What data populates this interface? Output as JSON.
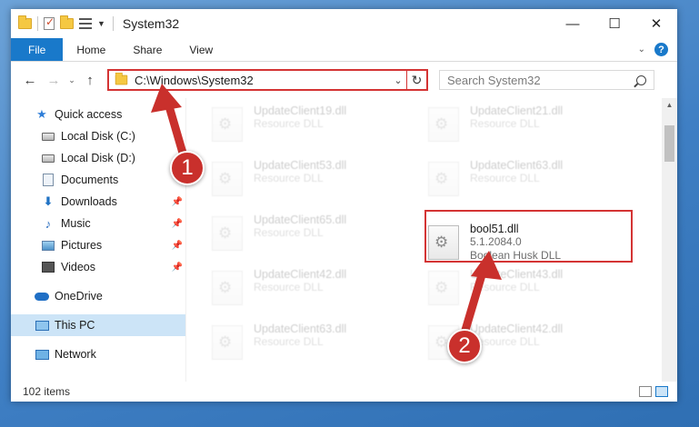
{
  "window": {
    "title": "System32",
    "controls": {
      "minimize": "—",
      "maximize": "☐",
      "close": "✕"
    }
  },
  "ribbon": {
    "tabs": [
      "File",
      "Home",
      "Share",
      "View"
    ]
  },
  "address": {
    "path": "C:\\Windows\\System32",
    "search_placeholder": "Search System32"
  },
  "sidebar": {
    "items": [
      {
        "label": "Quick access",
        "icon": "star-icon"
      },
      {
        "label": "Local Disk (C:)",
        "icon": "drive-icon"
      },
      {
        "label": "Local Disk (D:)",
        "icon": "drive-icon"
      },
      {
        "label": "Documents",
        "icon": "documents-icon"
      },
      {
        "label": "Downloads",
        "icon": "downloads-icon"
      },
      {
        "label": "Music",
        "icon": "music-icon"
      },
      {
        "label": "Pictures",
        "icon": "pictures-icon"
      },
      {
        "label": "Videos",
        "icon": "videos-icon"
      },
      {
        "label": "OneDrive",
        "icon": "onedrive-icon"
      },
      {
        "label": "This PC",
        "icon": "this-pc-icon"
      },
      {
        "label": "Network",
        "icon": "network-icon"
      }
    ]
  },
  "files": [
    {
      "name": "UpdateClient19.dll",
      "meta1": "Resource DLL",
      "meta2": ""
    },
    {
      "name": "UpdateClient21.dll",
      "meta1": "Resource DLL",
      "meta2": ""
    },
    {
      "name": "UpdateClient53.dll",
      "meta1": "Resource DLL",
      "meta2": ""
    },
    {
      "name": "UpdateClient63.dll",
      "meta1": "Resource DLL",
      "meta2": ""
    },
    {
      "name": "UpdateClient65.dll",
      "meta1": "Resource DLL",
      "meta2": ""
    },
    {
      "name": "bool51.dll",
      "meta1": "5.1.2084.0",
      "meta2": "Boolean Husk DLL"
    },
    {
      "name": "UpdateClient42.dll",
      "meta1": "Resource DLL",
      "meta2": ""
    },
    {
      "name": "UpdateClient43.dll",
      "meta1": "Resource DLL",
      "meta2": ""
    },
    {
      "name": "UpdateClient63.dll",
      "meta1": "Resource DLL",
      "meta2": ""
    },
    {
      "name": "UpdateClient42.dll",
      "meta1": "Resource DLL",
      "meta2": ""
    }
  ],
  "status": {
    "item_count": "102 items"
  },
  "annotations": {
    "step1": "1",
    "step2": "2",
    "color": "#c9302c"
  }
}
